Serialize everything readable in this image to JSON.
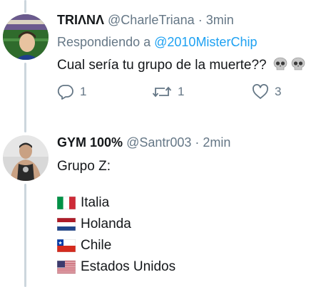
{
  "tweet1": {
    "name": "TRIΛNΛ",
    "handle": "@CharleTriana",
    "time": "· 3min",
    "reply_prefix": "Respondiendo a",
    "reply_handle": "@2010MisterChip",
    "text": "Cual sería tu grupo de la muerte??",
    "actions": {
      "reply_count": "1",
      "retweet_count": "1",
      "like_count": "3"
    }
  },
  "tweet2": {
    "name": "GYM 100%",
    "handle": "@Santr003",
    "time": "· 2min",
    "text": "Grupo Z:",
    "teams": [
      {
        "name": "Italia",
        "flag_icon": "flag-italy-icon"
      },
      {
        "name": "Holanda",
        "flag_icon": "flag-netherlands-icon"
      },
      {
        "name": "Chile",
        "flag_icon": "flag-chile-icon"
      },
      {
        "name": "Estados Unidos",
        "flag_icon": "flag-usa-icon"
      }
    ]
  },
  "colors": {
    "link": "#1da1f2",
    "secondary": "#657786",
    "thread_line": "#ccd6dd"
  }
}
